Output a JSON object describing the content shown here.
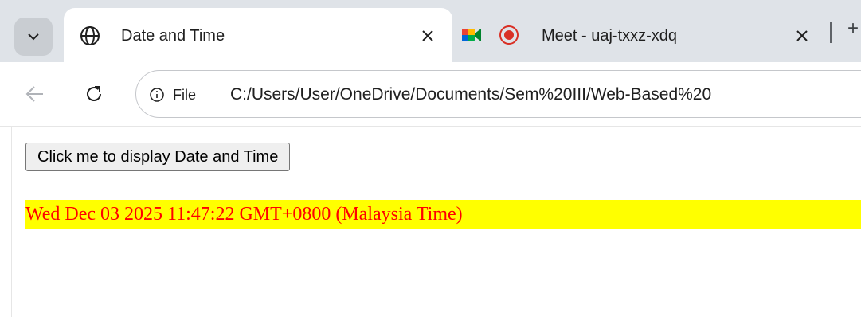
{
  "browser": {
    "tabs": [
      {
        "title": "Date and Time",
        "favicon": "globe-icon",
        "active": true
      },
      {
        "title": "Meet - uaj-txxz-xdq",
        "favicon": "google-meet-icon",
        "recording": true,
        "active": false
      }
    ],
    "new_tab_label": "+",
    "address": {
      "chip": "File",
      "url": "C:/Users/User/OneDrive/Documents/Sem%20III/Web-Based%20"
    }
  },
  "page": {
    "button_label": "Click me to display Date and Time",
    "datetime_text": "Wed Dec 03 2025 11:47:22 GMT+0800 (Malaysia Time)"
  },
  "colors": {
    "highlight_bg": "#ffff00",
    "highlight_text": "#ff0000",
    "recording": "#d93025"
  }
}
